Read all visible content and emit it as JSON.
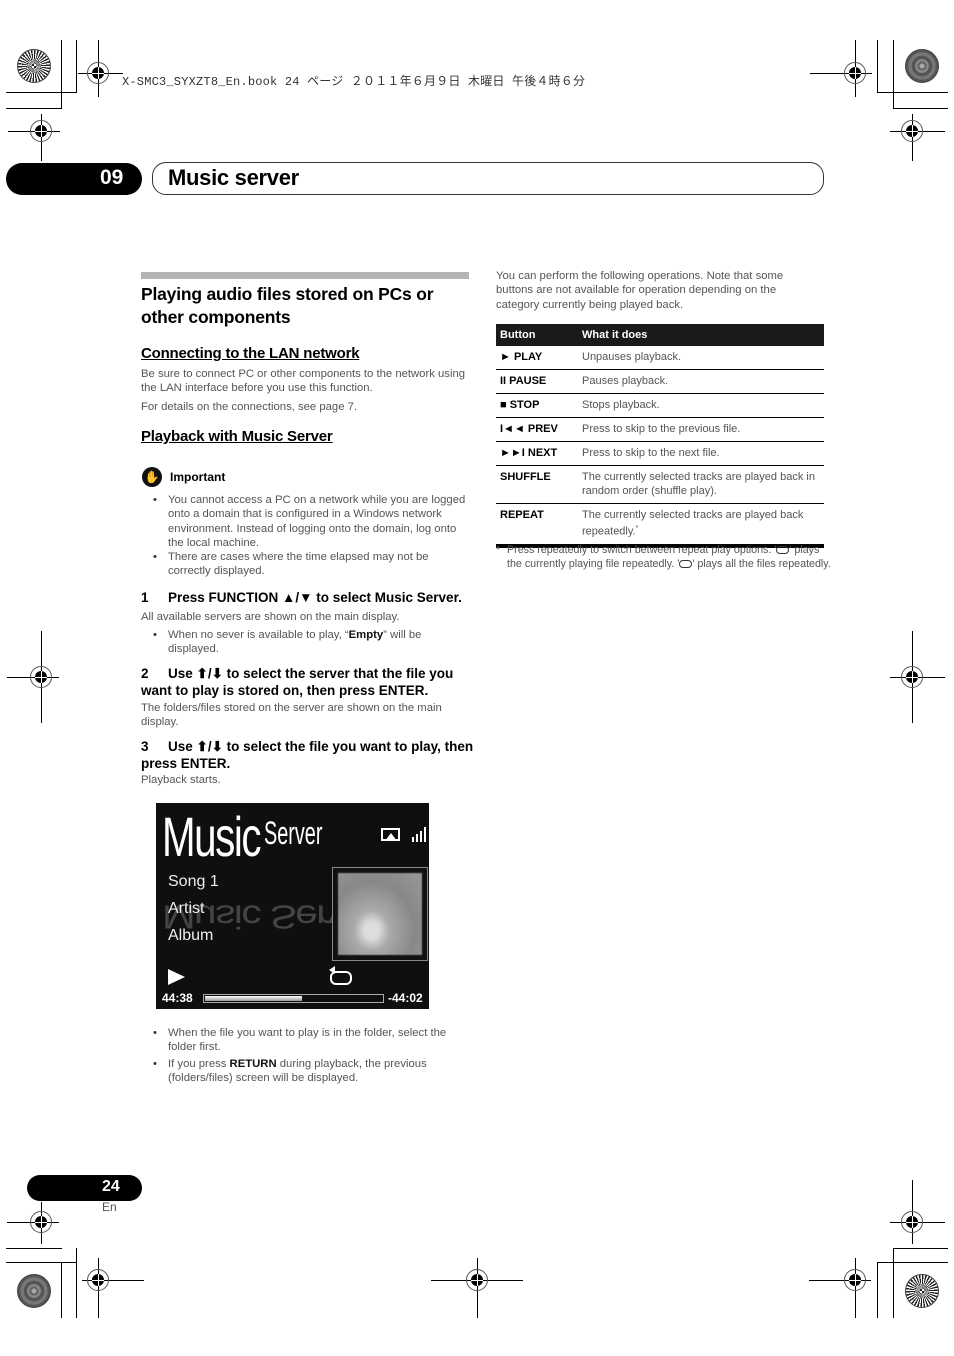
{
  "print_header": "X-SMC3_SYXZT8_En.book  24 ページ  ２０１１年６月９日  木曜日  午後４時６分",
  "chapter": {
    "number": "09",
    "title": "Music server"
  },
  "left": {
    "section_title": "Playing audio files stored on PCs or other components",
    "lan": {
      "heading": "Connecting to the LAN network",
      "para1": "Be sure to connect PC or other components to the network using the LAN interface before you use this function.",
      "para2": "For details on the connections, see page 7."
    },
    "playback": {
      "heading": "Playback with Music Server",
      "important_label": "Important",
      "important_bullets": [
        "You cannot access a PC on a network while you are logged onto a domain that is configured in a Windows network environment. Instead of logging onto the domain, log onto the local machine.",
        "There are cases where the time elapsed may not be correctly displayed."
      ],
      "step1": {
        "num": "1",
        "text": "Press FUNCTION ▲/▼ to select Music Server.",
        "desc": "All available servers are shown on the main display.",
        "bullet_pre": "When no sever is available to play, “",
        "bullet_bold": "Empty",
        "bullet_post": "” will be displayed."
      },
      "step2": {
        "num": "2",
        "text": "Use ⬆/⬇ to select the server that the file you want to play is stored on, then press ENTER.",
        "desc": "The folders/files stored on the server are shown on the main display."
      },
      "step3": {
        "num": "3",
        "text": "Use ⬆/⬇ to select the file you want to play, then press ENTER.",
        "desc": "Playback starts."
      }
    },
    "display": {
      "title_big": "Music",
      "title_small": "Server",
      "reflection": "Music Server",
      "song": "Song 1",
      "artist": "Artist",
      "album": "Album",
      "elapsed": "44:38",
      "remaining": "-44:02",
      "progress": 0.55,
      "icons": [
        "play-icon",
        "repeat-icon",
        "airplay-icon",
        "signal-icon",
        "album-art"
      ]
    },
    "after_bullets": {
      "b1": "When the file you want to play is in the folder, select the folder first.",
      "b2_pre": "If you press ",
      "b2_bold": "RETURN",
      "b2_post": " during playback, the previous (folders/files) screen will be displayed."
    }
  },
  "right": {
    "intro": "You can perform the following operations. Note that some buttons are not available for operation depending on the category currently being played back.",
    "table": {
      "headers": [
        "Button",
        "What it does"
      ],
      "rows": [
        {
          "button": "► PLAY",
          "action": "Unpauses playback."
        },
        {
          "button": "II PAUSE",
          "action": "Pauses playback."
        },
        {
          "button": "■ STOP",
          "action": "Stops playback."
        },
        {
          "button": "I◄◄ PREV",
          "action": "Press to skip to the previous file."
        },
        {
          "button": "►►I NEXT",
          "action": "Press to skip to the next file."
        },
        {
          "button": "SHUFFLE",
          "action": "The currently selected tracks are played back in random order (shuffle play)."
        },
        {
          "button": "REPEAT",
          "action": "The currently selected tracks are played back repeatedly.",
          "sup": "*"
        }
      ]
    },
    "footnote": {
      "mark": "*",
      "p1": "Press repeatedly to switch between repeat play options. '",
      "p2": "' plays the currently playing file repeatedly. '",
      "p3": "' plays all the files repeatedly."
    }
  },
  "footer": {
    "page": "24",
    "lang": "En"
  }
}
